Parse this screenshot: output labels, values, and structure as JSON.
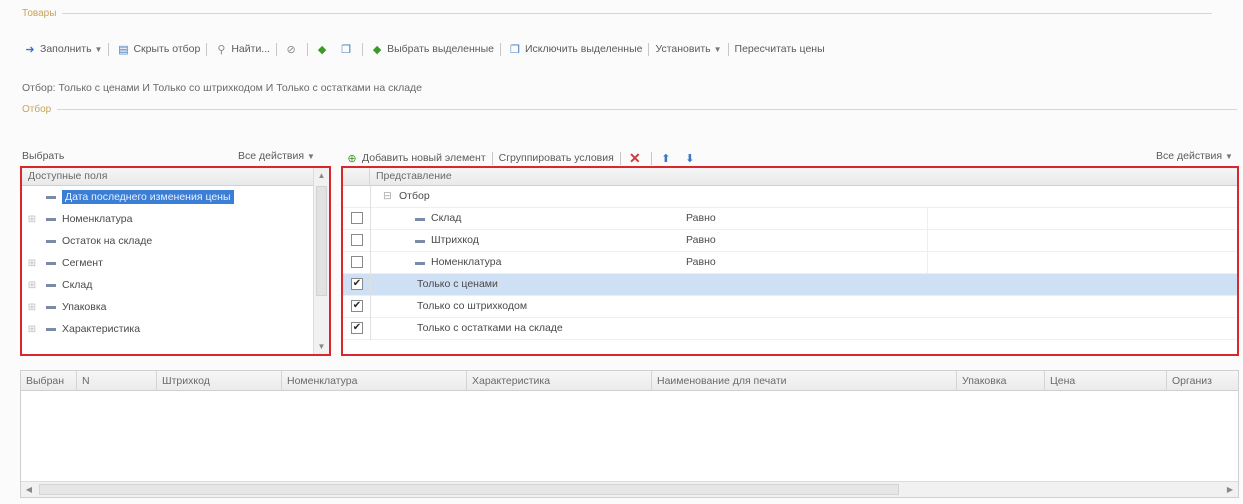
{
  "group_goods": {
    "title": "Товары"
  },
  "toolbar": {
    "fill_label": "Заполнить",
    "hide_filter_label": "Скрыть отбор",
    "find_label": "Найти...",
    "select_highlighted_label": "Выбрать выделенные",
    "exclude_highlighted_label": "Исключить выделенные",
    "set_label": "Установить",
    "recalc_prices_label": "Пересчитать цены"
  },
  "filter_summary": {
    "prefix": "Отбор:",
    "text": "Только с ценами И Только со штрихкодом И Только с остатками на складе"
  },
  "group_filter": {
    "title": "Отбор"
  },
  "filter_bar": {
    "choose_label": "Выбрать",
    "all_actions_left": "Все действия",
    "add_element_label": "Добавить новый элемент",
    "group_conditions_label": "Сгруппировать условия",
    "all_actions_right": "Все действия"
  },
  "available_fields": {
    "header": "Доступные поля",
    "items": [
      {
        "label": "Дата последнего изменения цены",
        "expandable": false,
        "selected": true
      },
      {
        "label": "Номенклатура",
        "expandable": true,
        "selected": false
      },
      {
        "label": "Остаток на складе",
        "expandable": false,
        "selected": false
      },
      {
        "label": "Сегмент",
        "expandable": true,
        "selected": false
      },
      {
        "label": "Склад",
        "expandable": true,
        "selected": false
      },
      {
        "label": "Упаковка",
        "expandable": true,
        "selected": false
      },
      {
        "label": "Характеристика",
        "expandable": true,
        "selected": false
      }
    ]
  },
  "conditions": {
    "header": "Представление",
    "group_label": "Отбор",
    "rows": [
      {
        "label": "Склад",
        "condition": "Равно",
        "checked": false,
        "is_field": true,
        "highlighted": false
      },
      {
        "label": "Штрихкод",
        "condition": "Равно",
        "checked": false,
        "is_field": true,
        "highlighted": false
      },
      {
        "label": "Номенклатура",
        "condition": "Равно",
        "checked": false,
        "is_field": true,
        "highlighted": false
      },
      {
        "label": "Только с ценами",
        "condition": "",
        "checked": true,
        "is_field": false,
        "highlighted": true
      },
      {
        "label": "Только со штрихкодом",
        "condition": "",
        "checked": true,
        "is_field": false,
        "highlighted": false
      },
      {
        "label": "Только с остатками на складе",
        "condition": "",
        "checked": true,
        "is_field": false,
        "highlighted": false
      }
    ]
  },
  "goods_table": {
    "columns": [
      "Выбран",
      "N",
      "Штрихкод",
      "Номенклатура",
      "Характеристика",
      "Наименование для печати",
      "Упаковка",
      "Цена",
      "Организ"
    ]
  }
}
